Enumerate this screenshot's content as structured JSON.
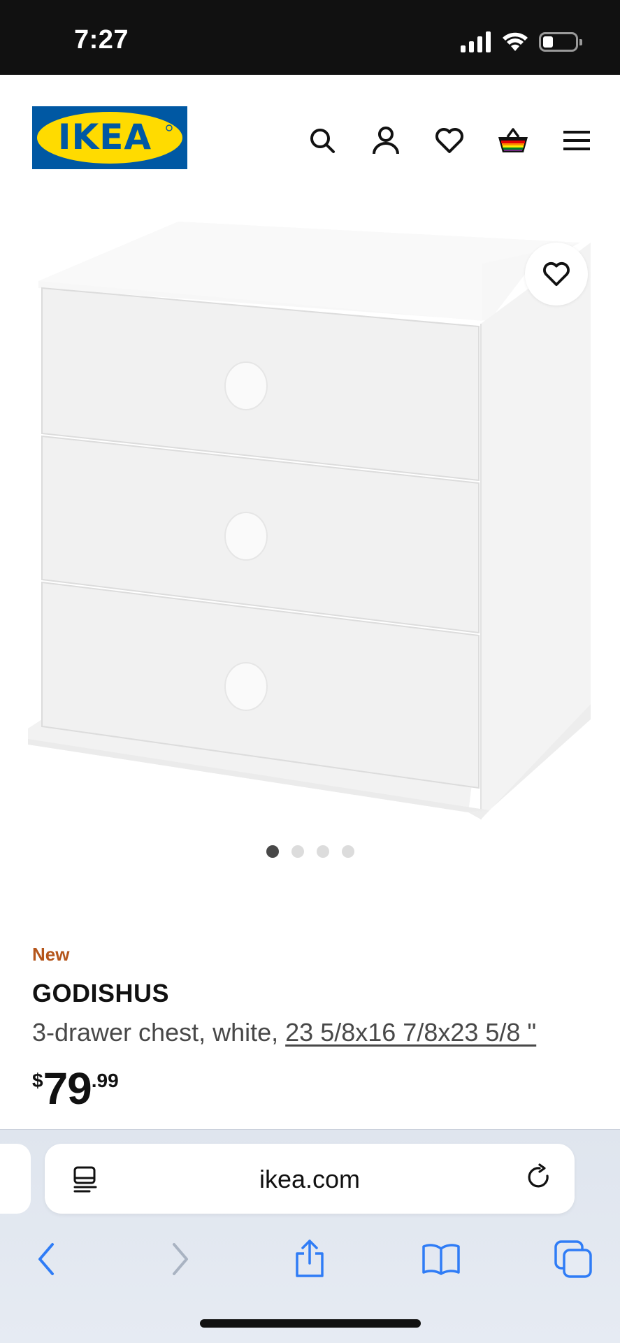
{
  "status_bar": {
    "time": "7:27"
  },
  "header": {
    "logo_text": "IKEA",
    "icons": [
      "search-icon",
      "account-icon",
      "wishlist-icon",
      "cart-icon",
      "menu-icon"
    ]
  },
  "gallery": {
    "image_count": 4,
    "active_index": 0
  },
  "product": {
    "badge": "New",
    "name": "GODISHUS",
    "description_prefix": "3-drawer chest, white, ",
    "dimensions": "23 5/8x16 7/8x23 5/8 \"",
    "price_currency": "$",
    "price_whole": "79",
    "price_decimal": ".99"
  },
  "browser": {
    "url": "ikea.com"
  },
  "colors": {
    "ikea_blue": "#0058a3",
    "ikea_yellow": "#ffdb00",
    "badge_orange": "#b5561b",
    "safari_blue": "#2f7cf6"
  }
}
